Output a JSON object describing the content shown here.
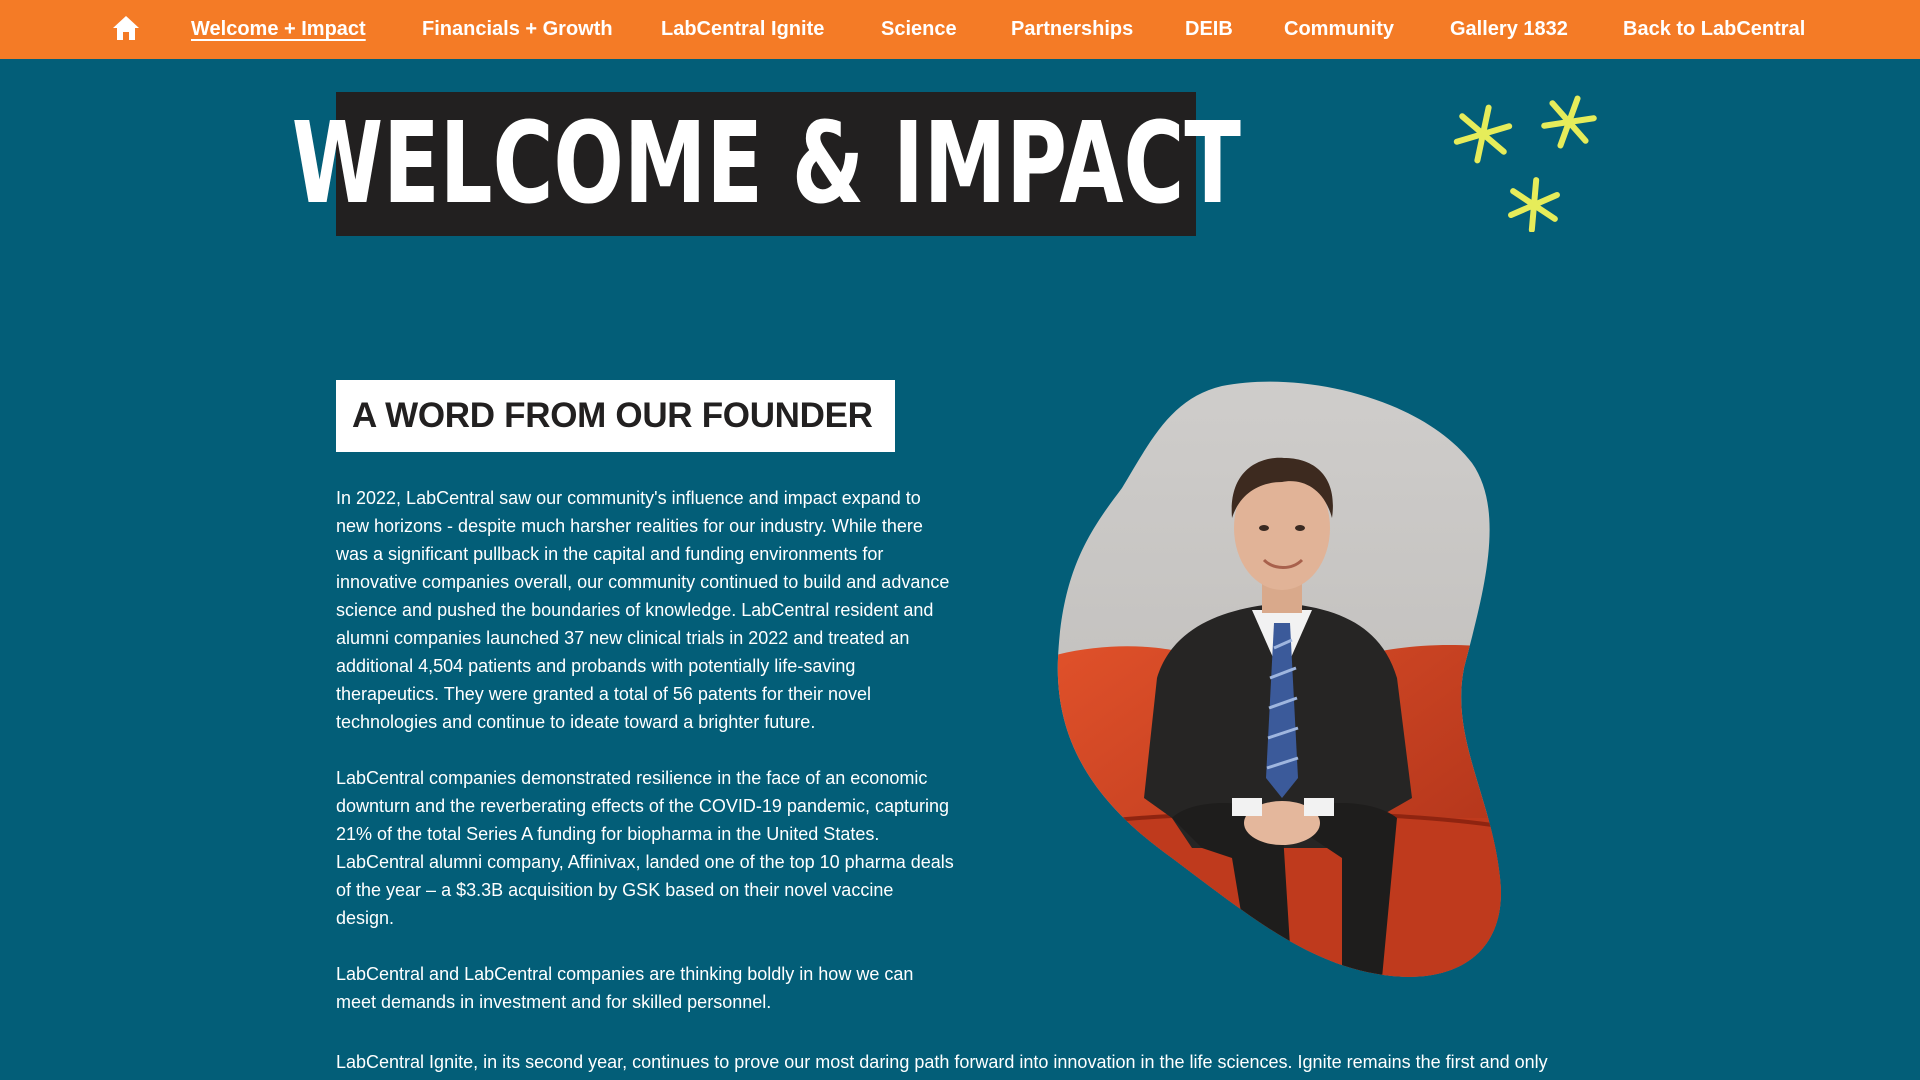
{
  "nav": {
    "home_icon": "home-icon",
    "items": [
      {
        "label": "Welcome + Impact",
        "active": true
      },
      {
        "label": "Financials + Growth"
      },
      {
        "label": "LabCentral Ignite"
      },
      {
        "label": "Science"
      },
      {
        "label": "Partnerships"
      },
      {
        "label": "DEIB"
      },
      {
        "label": "Community"
      },
      {
        "label": "Gallery 1832"
      },
      {
        "label": "Back to LabCentral"
      }
    ]
  },
  "hero": {
    "title": "WELCOME & IMPACT"
  },
  "decoration": {
    "icon": "asterisk-icon",
    "color": "#e6ec5a"
  },
  "founder": {
    "heading": "A WORD FROM OUR FOUNDER",
    "paragraphs": [
      "In 2022, LabCentral saw our community's influence and impact expand to new horizons - despite much harsher realities for our industry. While there was a significant pullback in the capital and funding environments for innovative companies overall, our community continued to build and advance science and pushed the boundaries of knowledge. LabCentral resident and alumni companies launched 37 new clinical trials in 2022 and treated an additional 4,504 patients and probands with potentially life-saving therapeutics. They were granted a total of 56 patents for their novel technologies and continue to ideate toward a brighter future.",
      "LabCentral companies demonstrated resilience in the face of an economic downturn and the reverberating effects of the COVID-19 pandemic, capturing 21% of the total Series A funding for biopharma in the United States. LabCentral alumni company, Affinivax, landed one of the top 10 pharma deals of the year – a $3.3B acquisition by GSK based on their novel vaccine design.",
      "LabCentral and LabCentral companies are thinking boldly in how we can meet demands in investment and for skilled personnel.",
      "LabCentral Ignite, in its second year, continues to prove our most daring path forward into innovation in the life sciences. Ignite remains the first and only"
    ]
  },
  "colors": {
    "nav_bg": "#f47b26",
    "page_bg": "#035e78",
    "hero_bg": "#222020",
    "accent": "#e6ec5a"
  }
}
